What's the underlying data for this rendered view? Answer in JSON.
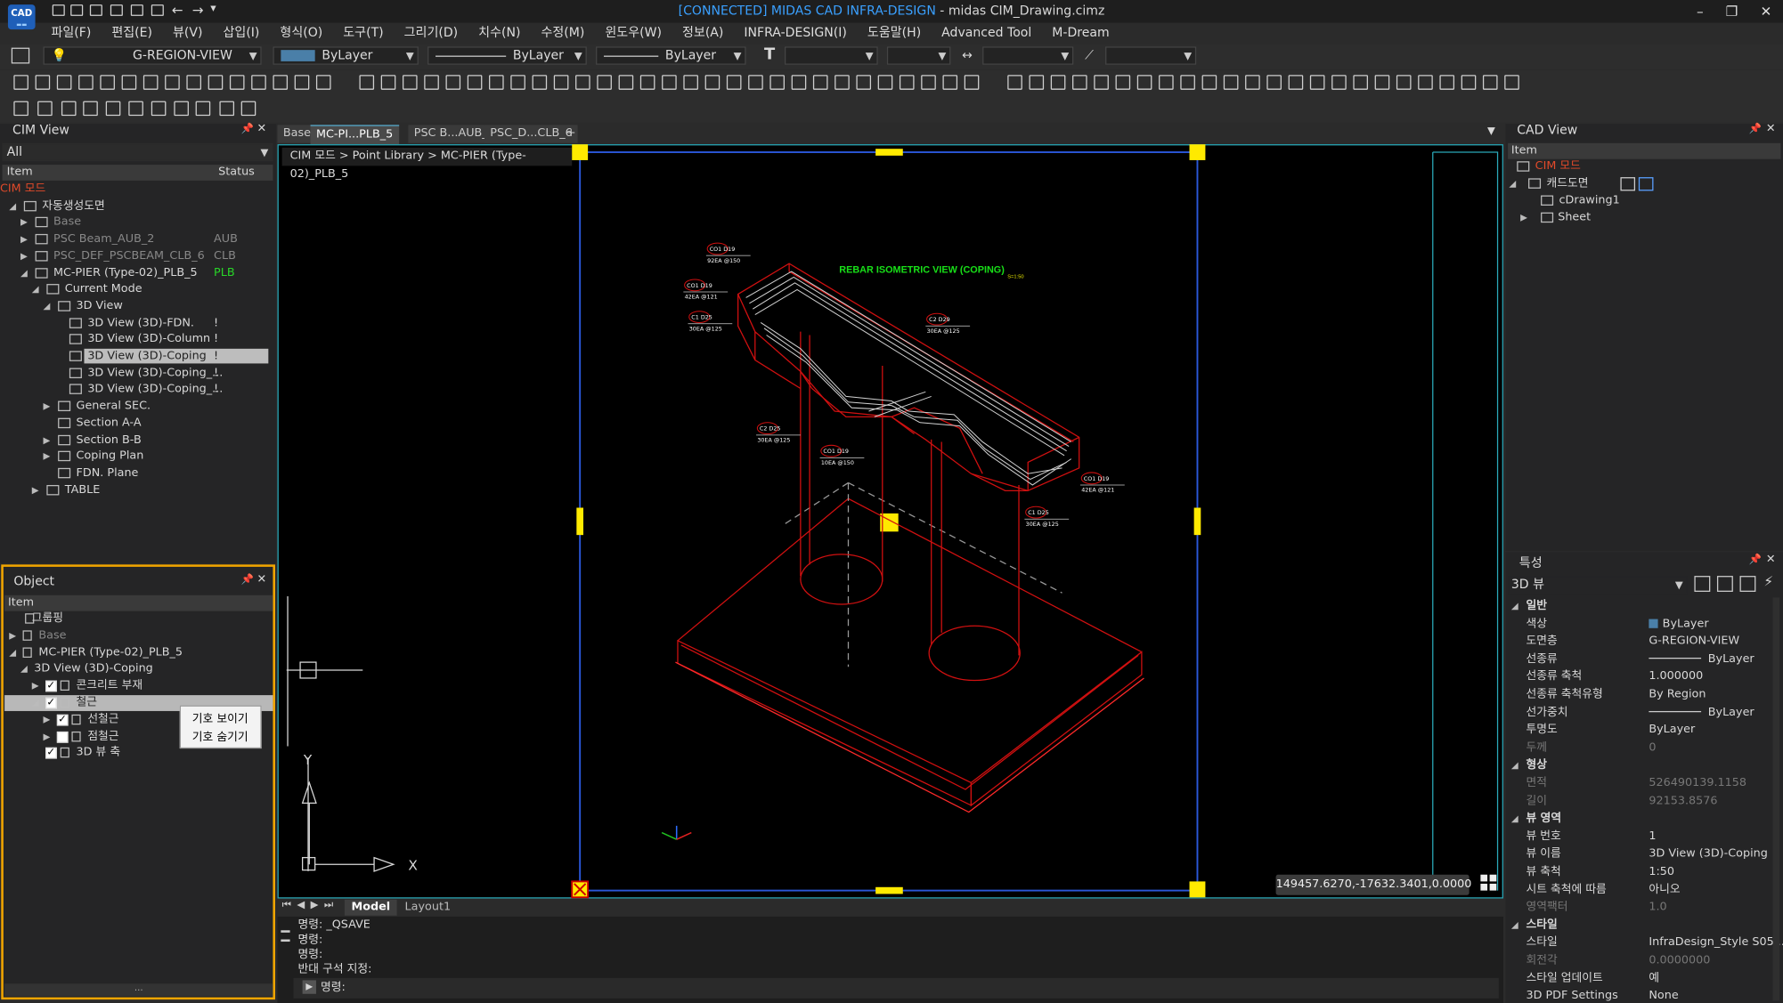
{
  "window": {
    "logo": "CAD",
    "connected": "[CONNECTED] MIDAS CAD INFRA-DESIGN",
    "title_rest": " - midas CIM_Drawing.cimz",
    "minimize": "–",
    "restore": "❐",
    "close": "✕"
  },
  "menu": [
    "파일(F)",
    "편집(E)",
    "뷰(V)",
    "삽입(I)",
    "형식(O)",
    "도구(T)",
    "그리기(D)",
    "치수(N)",
    "수정(M)",
    "윈도우(W)",
    "정보(A)",
    "INFRA-DESIGN(I)",
    "도움말(H)",
    "Advanced Tool",
    "M-Dream"
  ],
  "toolbar": {
    "layer": "G-REGION-VIEW",
    "color": "ByLayer",
    "linetype": "ByLayer",
    "lineweight": "ByLayer",
    "color_swatch": "#4a7fa8"
  },
  "cim_view": {
    "title": "CIM View",
    "filter": "All",
    "col_item": "Item",
    "col_status": "Status",
    "items": [
      {
        "label": "CIM 모드",
        "status": ""
      },
      {
        "label": "자동생성도면",
        "status": ""
      },
      {
        "label": "Base",
        "status": ""
      },
      {
        "label": "PSC Beam_AUB_2",
        "status": "AUB"
      },
      {
        "label": "PSC_DEF_PSCBEAM_CLB_6",
        "status": "CLB"
      },
      {
        "label": "MC-PIER (Type-02)_PLB_5",
        "status": "PLB"
      },
      {
        "label": "Current Mode",
        "status": ""
      },
      {
        "label": "3D View",
        "status": ""
      },
      {
        "label": "3D View (3D)-FDN.",
        "status": "!"
      },
      {
        "label": "3D View (3D)-Column",
        "status": "!"
      },
      {
        "label": "3D View (3D)-Coping",
        "status": "!"
      },
      {
        "label": "3D View (3D)-Coping_...",
        "status": "!"
      },
      {
        "label": "3D View (3D)-Coping_...",
        "status": "!"
      },
      {
        "label": "General SEC.",
        "status": ""
      },
      {
        "label": "Section A-A",
        "status": ""
      },
      {
        "label": "Section B-B",
        "status": ""
      },
      {
        "label": "Coping Plan",
        "status": ""
      },
      {
        "label": "FDN. Plane",
        "status": ""
      },
      {
        "label": "TABLE",
        "status": ""
      }
    ]
  },
  "object_panel": {
    "title": "Object",
    "col_item": "Item",
    "items": [
      {
        "label": "그룹핑"
      },
      {
        "label": "Base"
      },
      {
        "label": "MC-PIER (Type-02)_PLB_5"
      },
      {
        "label": "3D View (3D)-Coping"
      },
      {
        "label": "콘크리트 부재"
      },
      {
        "label": "철근"
      },
      {
        "label": "선철근"
      },
      {
        "label": "점철근"
      },
      {
        "label": "3D 뷰 축"
      }
    ],
    "context_menu": [
      "기호 보이기",
      "기호 숨기기"
    ],
    "footer": "..."
  },
  "tabs": [
    "Base",
    "MC-PI...PLB_5",
    "PSC B...AUB_2",
    "PSC_D...CLB_6",
    "+"
  ],
  "breadcrumb": "CIM 모드 > Point Library > MC-PIER (Type-02)_PLB_5",
  "drawing": {
    "title": "REBAR ISOMETRIC VIEW (COPING)",
    "scale": "S=1:50",
    "labels": [
      {
        "t1": "CO1  D19",
        "t2": "92EA @150"
      },
      {
        "t1": "CO1  D19",
        "t2": "42EA @121"
      },
      {
        "t1": "C1  D25",
        "t2": "30EA @125"
      },
      {
        "t1": "C2  D29",
        "t2": "30EA @125"
      },
      {
        "t1": "C2  D25",
        "t2": "30EA @125"
      },
      {
        "t1": "CO1  D19",
        "t2": "10EA @150"
      },
      {
        "t1": "CO1  D19",
        "t2": "42EA @121"
      },
      {
        "t1": "C1  D25",
        "t2": "30EA @125"
      }
    ],
    "axis_x": "X",
    "axis_y": "Y"
  },
  "coords": "149457.6270,-17632.3401,0.0000",
  "layout_tabs": [
    "Model",
    "Layout1"
  ],
  "command": {
    "lines": [
      "명령: _QSAVE",
      "명령:",
      "명령:",
      "반대 구석 지정:"
    ],
    "prompt": "명령:"
  },
  "cad_view": {
    "title": "CAD View",
    "col_item": "Item",
    "items": [
      "CIM 모드",
      "캐드도면",
      "cDrawing1",
      "Sheet"
    ]
  },
  "properties": {
    "title": "특성",
    "selector": "3D 뷰",
    "rows": [
      {
        "k": "일반",
        "v": "",
        "sec": true
      },
      {
        "k": "색상",
        "v": "ByLayer"
      },
      {
        "k": "도면층",
        "v": "G-REGION-VIEW"
      },
      {
        "k": "선종류",
        "v": "ByLayer"
      },
      {
        "k": "선종류 축척",
        "v": "1.000000"
      },
      {
        "k": "선종류 축척유형",
        "v": "By Region"
      },
      {
        "k": "선가중치",
        "v": "ByLayer"
      },
      {
        "k": "투명도",
        "v": "ByLayer"
      },
      {
        "k": "두께",
        "v": "0",
        "dim": true
      },
      {
        "k": "형상",
        "v": "",
        "sec": true
      },
      {
        "k": "면적",
        "v": "526490139.1158",
        "dim": true
      },
      {
        "k": "길이",
        "v": "92153.8576",
        "dim": true
      },
      {
        "k": "뷰 영역",
        "v": "",
        "sec": true
      },
      {
        "k": "뷰 번호",
        "v": "1"
      },
      {
        "k": "뷰 이름",
        "v": "3D View (3D)-Coping"
      },
      {
        "k": "뷰 축척",
        "v": "1:50"
      },
      {
        "k": "시트 축척에 따름",
        "v": "아니오"
      },
      {
        "k": "영역팩터",
        "v": "1.0",
        "dim": true
      },
      {
        "k": "스타일",
        "v": "",
        "sec": true
      },
      {
        "k": "스타일",
        "v": "InfraDesign_Style S05 ..."
      },
      {
        "k": "회전각",
        "v": "0.0000000",
        "dim": true
      },
      {
        "k": "스타일 업데이트",
        "v": "예"
      },
      {
        "k": "3D PDF Settings",
        "v": "None"
      }
    ]
  }
}
